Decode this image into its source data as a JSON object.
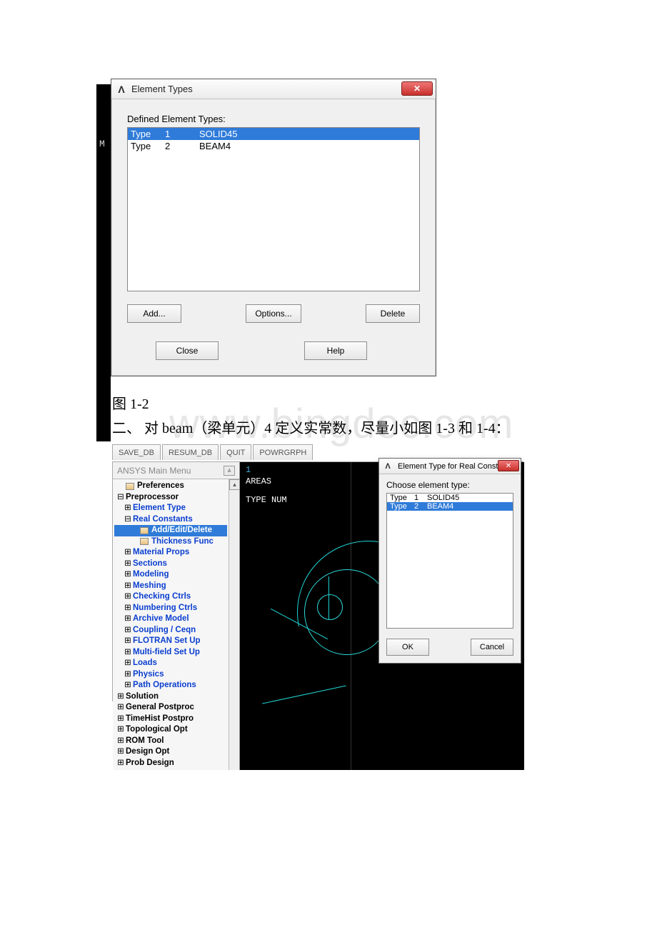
{
  "dialog1": {
    "title": "Element Types",
    "section_label": "Defined Element Types:",
    "rows": [
      {
        "col1": "Type",
        "col2": "1",
        "col3": "SOLID45",
        "selected": true
      },
      {
        "col1": "Type",
        "col2": "2",
        "col3": "BEAM4",
        "selected": false
      }
    ],
    "buttons": {
      "add": "Add...",
      "options": "Options...",
      "delete": "Delete",
      "close": "Close",
      "help": "Help"
    }
  },
  "caption": "图 1-2",
  "heading": "二、 对 beam（梁单元）4 定义实常数，尽量小如图 1-3 和 1-4：",
  "watermark": "www.bingdoc.com",
  "toolbar": [
    "SAVE_DB",
    "RESUM_DB",
    "QUIT",
    "POWRGRPH"
  ],
  "menu_header": "ANSYS Main Menu",
  "menu": [
    {
      "indent": 0,
      "tw": "",
      "icon": true,
      "label": "Preferences",
      "cls": "bold"
    },
    {
      "indent": 0,
      "tw": "⊟",
      "label": "Preprocessor",
      "cls": "bold"
    },
    {
      "indent": 1,
      "tw": "⊞",
      "label": "Element Type",
      "cls": "link-blue"
    },
    {
      "indent": 1,
      "tw": "⊟",
      "label": "Real Constants",
      "cls": "link-blue"
    },
    {
      "indent": 2,
      "tw": "",
      "icon": true,
      "label": "Add/Edit/Delete",
      "cls": "link-blue",
      "selected": true
    },
    {
      "indent": 2,
      "tw": "",
      "icon": true,
      "label": "Thickness Func",
      "cls": "link-blue"
    },
    {
      "indent": 1,
      "tw": "⊞",
      "label": "Material Props",
      "cls": "link-blue"
    },
    {
      "indent": 1,
      "tw": "⊞",
      "label": "Sections",
      "cls": "link-blue"
    },
    {
      "indent": 1,
      "tw": "⊞",
      "label": "Modeling",
      "cls": "link-blue"
    },
    {
      "indent": 1,
      "tw": "⊞",
      "label": "Meshing",
      "cls": "link-blue"
    },
    {
      "indent": 1,
      "tw": "⊞",
      "label": "Checking Ctrls",
      "cls": "link-blue"
    },
    {
      "indent": 1,
      "tw": "⊞",
      "label": "Numbering Ctrls",
      "cls": "link-blue"
    },
    {
      "indent": 1,
      "tw": "⊞",
      "label": "Archive Model",
      "cls": "link-blue"
    },
    {
      "indent": 1,
      "tw": "⊞",
      "label": "Coupling / Ceqn",
      "cls": "link-blue"
    },
    {
      "indent": 1,
      "tw": "⊞",
      "label": "FLOTRAN Set Up",
      "cls": "link-blue"
    },
    {
      "indent": 1,
      "tw": "⊞",
      "label": "Multi-field Set Up",
      "cls": "link-blue"
    },
    {
      "indent": 1,
      "tw": "⊞",
      "label": "Loads",
      "cls": "link-blue"
    },
    {
      "indent": 1,
      "tw": "⊞",
      "label": "Physics",
      "cls": "link-blue"
    },
    {
      "indent": 1,
      "tw": "⊞",
      "label": "Path Operations",
      "cls": "link-blue"
    },
    {
      "indent": 0,
      "tw": "⊞",
      "label": "Solution",
      "cls": "bold"
    },
    {
      "indent": 0,
      "tw": "⊞",
      "label": "General Postproc",
      "cls": "bold"
    },
    {
      "indent": 0,
      "tw": "⊞",
      "label": "TimeHist Postpro",
      "cls": "bold"
    },
    {
      "indent": 0,
      "tw": "⊞",
      "label": "Topological Opt",
      "cls": "bold"
    },
    {
      "indent": 0,
      "tw": "⊞",
      "label": "ROM Tool",
      "cls": "bold"
    },
    {
      "indent": 0,
      "tw": "⊞",
      "label": "Design Opt",
      "cls": "bold"
    },
    {
      "indent": 0,
      "tw": "⊞",
      "label": "Prob Design",
      "cls": "bold"
    }
  ],
  "viewport": {
    "num": "1",
    "areas": "AREAS",
    "type": "TYPE NUM"
  },
  "dialog2": {
    "title": "Element Type for Real Consta...",
    "label": "Choose element type:",
    "rows": [
      {
        "c1": "Type",
        "c2": "1",
        "c3": "SOLID45",
        "selected": false
      },
      {
        "c1": "Type",
        "c2": "2",
        "c3": "BEAM4",
        "selected": true
      }
    ],
    "ok": "OK",
    "cancel": "Cancel"
  },
  "bg_letter": "M"
}
